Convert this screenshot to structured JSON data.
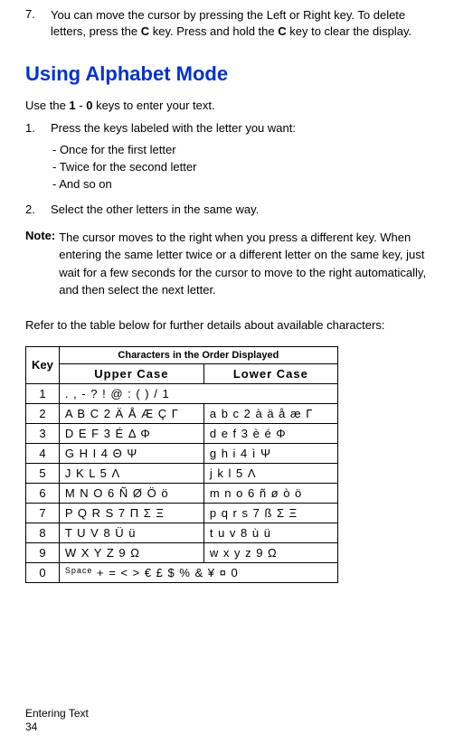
{
  "item7": {
    "num": "7.",
    "text_prefix": "You can move the cursor by pressing the Left or Right key. To delete letters, press the ",
    "key1": "C",
    "text_mid": " key. Press and hold the ",
    "key2": "C",
    "text_suffix": " key to clear the display."
  },
  "heading": "Using Alphabet Mode",
  "intro_prefix": "Use the ",
  "intro_key1": "1",
  "intro_mid": " - ",
  "intro_key2": "0",
  "intro_suffix": " keys to enter your text.",
  "steps": [
    {
      "num": "1.",
      "text": "Press the keys labeled with the letter you want:"
    },
    {
      "num": "2.",
      "text": "Select the other letters in the same way."
    }
  ],
  "sublist": [
    "- Once for the first letter",
    "- Twice for the second letter",
    "- And so on"
  ],
  "note_label": "Note:",
  "note_text": "The cursor moves to the right when you press a different key. When entering the same letter twice or a different letter on the same key, just wait for a few seconds for the cursor to move to the right automatically, and then select the next letter.",
  "table_intro": "Refer to the table below for further details about available characters:",
  "table": {
    "header_key": "Key",
    "header_main": "Characters in the Order Displayed",
    "header_upper": "Upper Case",
    "header_lower": "Lower Case",
    "rows": [
      {
        "key": "1",
        "upper": ". , - ? ! @ : ( ) / 1",
        "lower": ""
      },
      {
        "key": "2",
        "upper": "A B C 2 Ä Å Æ Ç Γ",
        "lower": "a b c 2 à ä å æ Γ"
      },
      {
        "key": "3",
        "upper": "D E F 3 É Δ Φ",
        "lower": "d e f 3 è é Φ"
      },
      {
        "key": "4",
        "upper": "G H I 4 Θ Ψ",
        "lower": "g h i 4 ì Ψ"
      },
      {
        "key": "5",
        "upper": "J K L 5 Λ",
        "lower": "j k l 5 Λ"
      },
      {
        "key": "6",
        "upper": "M N O 6 Ñ Ø Ö ö",
        "lower": "m n o 6 ñ ø ò ö"
      },
      {
        "key": "7",
        "upper": "P Q R S 7 Π Σ Ξ",
        "lower": "p q r s 7 ß Σ Ξ"
      },
      {
        "key": "8",
        "upper": "T U V 8 Ü ü",
        "lower": "t u v 8 ù ü"
      },
      {
        "key": "9",
        "upper": "W X Y Z 9 Ω",
        "lower": "w x y z 9 Ω"
      },
      {
        "key": "0",
        "upper_prefix": "Space",
        "upper": " + = < > € £ $ % & ¥ ¤ 0",
        "lower": ""
      }
    ]
  },
  "footer_section": "Entering Text",
  "footer_page": "34"
}
